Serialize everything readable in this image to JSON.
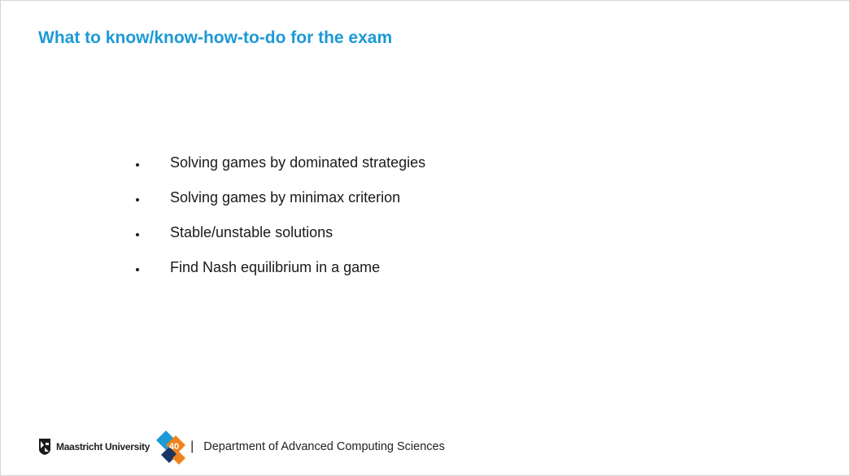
{
  "slide": {
    "title": "What to know/know-how-to-do for the exam",
    "bullets": [
      "Solving games by dominated strategies",
      "Solving games by minimax criterion",
      "Stable/unstable solutions",
      "Find Nash equilibrium in a game"
    ]
  },
  "footer": {
    "university": "Maastricht University",
    "anniversary_mark": "40",
    "divider": "|",
    "department": "Department of Advanced Computing Sciences"
  },
  "colors": {
    "title": "#1c9ad6",
    "body_text": "#1a1a1a",
    "logo_orange": "#f0821e",
    "logo_blue": "#1c9ad6",
    "logo_navy": "#1b3664"
  }
}
